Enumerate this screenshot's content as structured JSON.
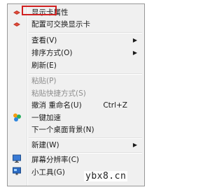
{
  "menu": {
    "items": [
      {
        "label": "显示卡属性",
        "icon": "graphics-card-icon",
        "highlighted": true
      },
      {
        "label": "配置可交换显示卡",
        "icon": "graphics-card-icon"
      },
      {
        "label": "查看(V)",
        "submenu": true
      },
      {
        "label": "排序方式(O)",
        "submenu": true
      },
      {
        "label": "刷新(E)"
      },
      {
        "label": "粘贴(P)",
        "disabled": true
      },
      {
        "label": "粘贴快捷方式(S)",
        "disabled": true
      },
      {
        "label": "撤消 重命名(U)",
        "shortcut": "Ctrl+Z"
      },
      {
        "label": "一键加速",
        "icon": "speedup-icon"
      },
      {
        "label": "下一个桌面背景(N)"
      },
      {
        "label": "新建(W)",
        "submenu": true
      },
      {
        "label": "屏幕分辨率(C)",
        "icon": "monitor-icon"
      },
      {
        "label": "小工具(G)",
        "icon": "gadgets-icon"
      }
    ],
    "submenu_arrow": "▶"
  },
  "watermark": "ybx8.cn",
  "colors": {
    "menu_bg": "#f0f0f0",
    "highlight_border": "#d02020",
    "disabled_text": "#8d8d8d"
  }
}
